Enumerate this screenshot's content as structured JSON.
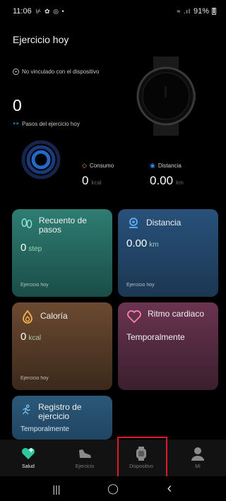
{
  "status_bar": {
    "time": "11:06",
    "battery": "91%",
    "left_icons": "⊬ ✿ ◎ •",
    "right_icons": "≈ .ıl"
  },
  "page": {
    "title": "Ejercicio hoy"
  },
  "device": {
    "link_status": "No vinculado con el dispositivo"
  },
  "steps": {
    "value": "0",
    "caption": "Pasos del ejercicio hoy"
  },
  "metrics": {
    "consumo": {
      "label": "Consumo",
      "value": "0",
      "unit": "kcal",
      "color": "#f0a030"
    },
    "distancia": {
      "label": "Distancia",
      "value": "0.00",
      "unit": "km",
      "color": "#2f8be8"
    }
  },
  "cards": {
    "steps": {
      "title": "Recuento de pasos",
      "value": "0",
      "unit": "step",
      "footer": "Ejercicio hoy"
    },
    "distance": {
      "title": "Distancia",
      "value": "0.00",
      "unit": "km",
      "footer": "Ejercicio hoy"
    },
    "calories": {
      "title": "Caloría",
      "value": "0",
      "unit": "kcal",
      "footer": "Ejercicio hoy"
    },
    "heart_rate": {
      "title": "Ritmo cardiaco",
      "text": "Temporalmente"
    },
    "exercise_record": {
      "title": "Registro de ejercicio",
      "text": "Temporalmente"
    }
  },
  "tabs": [
    {
      "label": "Salud",
      "icon": "heart-plus-icon",
      "active": true
    },
    {
      "label": "Ejercicio",
      "icon": "shoe-icon",
      "active": false
    },
    {
      "label": "Dispositivo",
      "icon": "watch-icon",
      "active": false
    },
    {
      "label": "Mi",
      "icon": "person-icon",
      "active": false
    }
  ],
  "nav": {
    "recents": "|||",
    "home": "◯",
    "back": "‹"
  }
}
